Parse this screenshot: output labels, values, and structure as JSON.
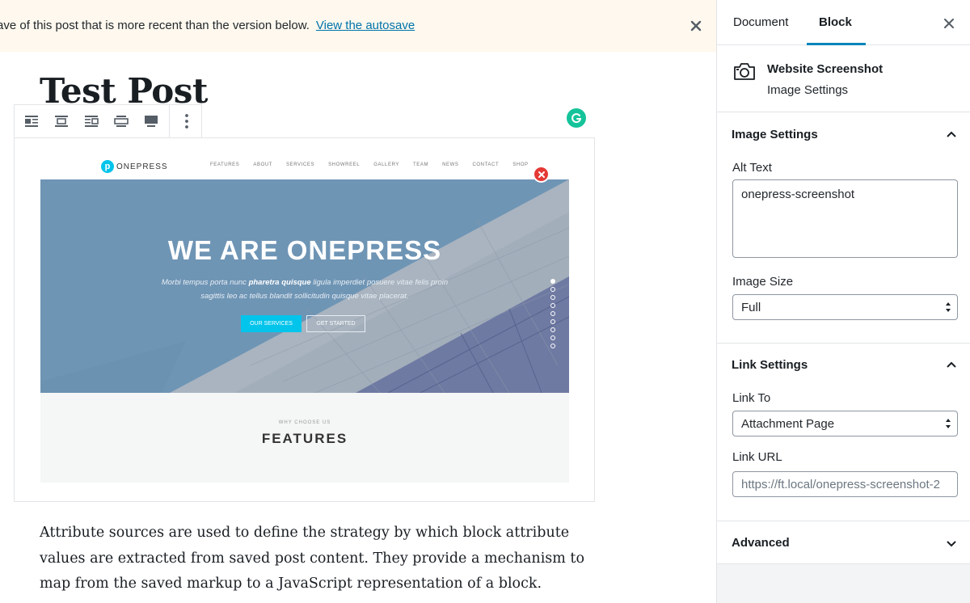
{
  "notice": {
    "text": "ave of this post that is more recent than the version below.",
    "link": "View the autosave"
  },
  "post": {
    "title": "Test Post",
    "paragraph": "Attribute sources are used to define the strategy by which block attribute values are extracted from saved post content. They provide a mechanism to map from the saved markup to a JavaScript representation of a block."
  },
  "toolbar": {
    "buttons": [
      "align-left-icon",
      "align-center-icon",
      "align-right-icon",
      "wide-width-icon",
      "full-width-icon",
      "more-options-icon"
    ]
  },
  "image": {
    "logo": "ONEPRESS",
    "logo_mark": "p",
    "menu": [
      "FEATURES",
      "ABOUT",
      "SERVICES",
      "SHOWREEL",
      "GALLERY",
      "TEAM",
      "NEWS",
      "CONTACT",
      "SHOP"
    ],
    "hero_title": "WE ARE ONEPRESS",
    "hero_sub_1": "Morbi tempus porta nunc ",
    "hero_sub_bold": "pharetra quisque",
    "hero_sub_2": " ligula imperdiet posuere vitae felis proin sagittis leo ac tellus blandit sollicitudin quisque vitae placerat.",
    "btn_primary": "OUR SERVICES",
    "btn_secondary": "GET STARTED",
    "features_kicker": "WHY CHOOSE US",
    "features_title": "FEATURES",
    "slider_dots": 9,
    "active_dot": 1
  },
  "sidebar": {
    "tabs": {
      "document": "Document",
      "block": "Block"
    },
    "block_card": {
      "title": "Website Screenshot",
      "description": "Image Settings"
    },
    "image_settings": {
      "title": "Image Settings",
      "alt_label": "Alt Text",
      "alt_value": "onepress-screenshot",
      "size_label": "Image Size",
      "size_value": "Full"
    },
    "link_settings": {
      "title": "Link Settings",
      "link_to_label": "Link To",
      "link_to_value": "Attachment Page",
      "url_label": "Link URL",
      "url_value": "https://ft.local/onepress-screenshot-2"
    },
    "advanced": {
      "title": "Advanced"
    }
  },
  "colors": {
    "accent": "#0085ba",
    "notice_bg": "#fef8ee",
    "link": "#0073aa",
    "onepress_cyan": "#03c4eb",
    "grammarly": "#15c39a",
    "remove": "#e53935"
  }
}
